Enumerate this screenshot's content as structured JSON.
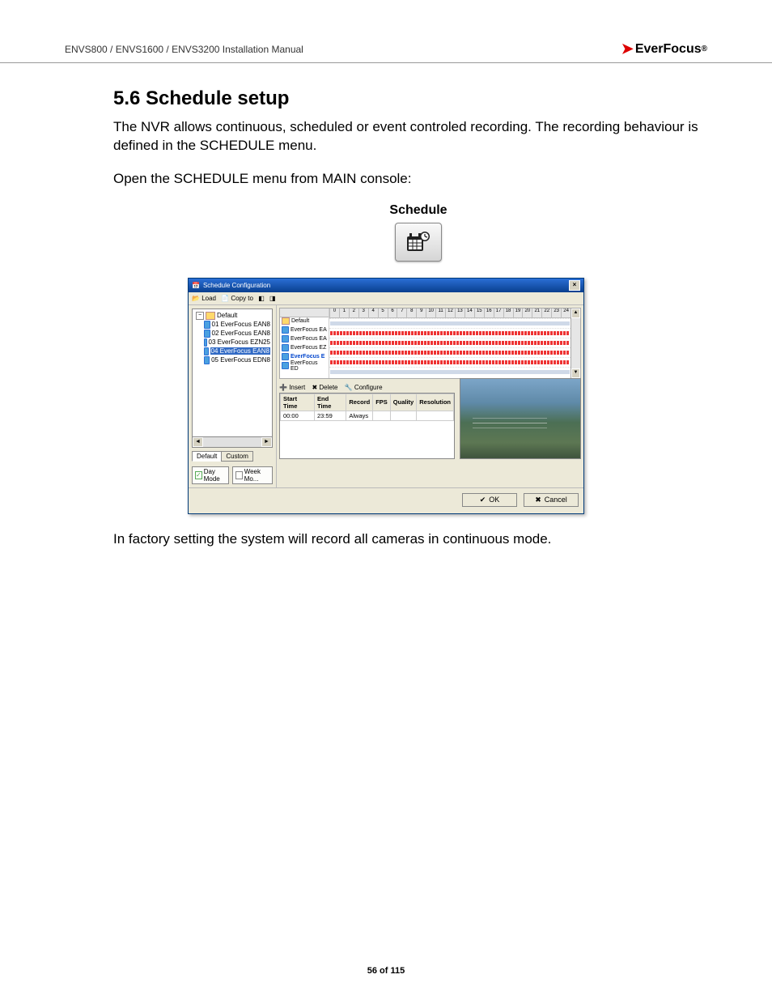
{
  "header": {
    "left": "ENVS800 / ENVS1600 / ENVS3200 Installation Manual",
    "brand": "EverFocus"
  },
  "section": {
    "heading": "5.6   Schedule setup",
    "para1": "The NVR allows continuous, scheduled or event controled recording. The recording behaviour is defined in the SCHEDULE menu.",
    "para2": "Open the SCHEDULE menu from MAIN console:",
    "schedule_label": "Schedule",
    "para3": "In factory setting the system will record all cameras in continuous mode."
  },
  "dialog": {
    "title": "Schedule Configuration",
    "toolbar": {
      "load": "Load",
      "copyto": "Copy to"
    },
    "tree": {
      "root": "Default",
      "items": [
        "01 EverFocus EAN8",
        "02 EverFocus EAN8",
        "03 EverFocus EZN25",
        "04 EverFocus EAN8",
        "05 EverFocus EDN8"
      ],
      "highlighted_index": 3
    },
    "tabs": {
      "default": "Default",
      "custom": "Custom"
    },
    "modes": {
      "day": "Day Mode",
      "week": "Week Mo..."
    },
    "timeline": {
      "hours": [
        "0",
        "1",
        "2",
        "3",
        "4",
        "5",
        "6",
        "7",
        "8",
        "9",
        "10",
        "11",
        "12",
        "13",
        "14",
        "15",
        "16",
        "17",
        "18",
        "19",
        "20",
        "21",
        "22",
        "23",
        "24"
      ],
      "rows": [
        {
          "label": "Default",
          "bold": false,
          "type": "folder",
          "light": true
        },
        {
          "label": "EverFocus EA",
          "bold": false,
          "type": "cam",
          "light": false
        },
        {
          "label": "EverFocus EA",
          "bold": false,
          "type": "cam",
          "light": false
        },
        {
          "label": "EverFocus EZ",
          "bold": false,
          "type": "cam",
          "light": false
        },
        {
          "label": "EverFocus E",
          "bold": true,
          "type": "cam",
          "light": false
        },
        {
          "label": "EverFocus ED",
          "bold": false,
          "type": "cam",
          "light": true
        }
      ]
    },
    "seg_toolbar": {
      "insert": "Insert",
      "delete": "Delete",
      "configure": "Configure"
    },
    "seg_table": {
      "headers": [
        "Start Time",
        "End Time",
        "Record",
        "FPS",
        "Quality",
        "Resolution"
      ],
      "row": {
        "start": "00:00",
        "end": "23:59",
        "record": "Always",
        "fps": "",
        "quality": "",
        "resolution": ""
      }
    },
    "buttons": {
      "ok": "OK",
      "cancel": "Cancel"
    }
  },
  "footer": {
    "page": "56 of 115"
  }
}
